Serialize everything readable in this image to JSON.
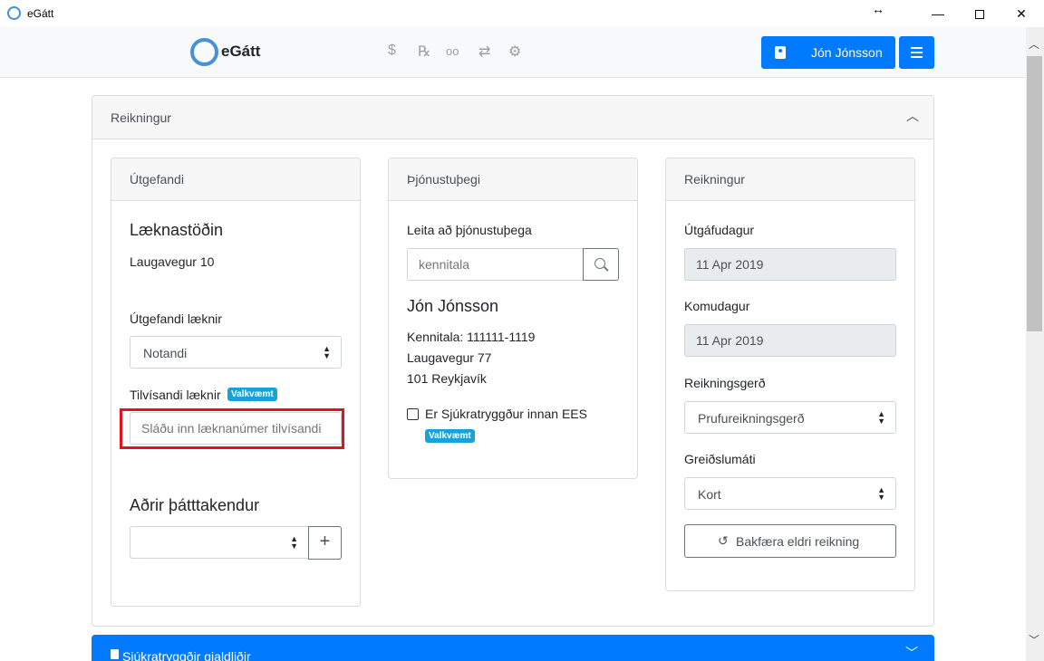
{
  "window": {
    "title": "eGátt",
    "resize_glyph": "↔",
    "minimize_glyph": "—",
    "close_glyph": "✕"
  },
  "header": {
    "logo_text": "eGátt",
    "nav_icons": [
      {
        "name": "dollar-icon",
        "glyph": "$"
      },
      {
        "name": "prescription-icon",
        "glyph": "℞"
      },
      {
        "name": "glasses-icon",
        "glyph": "oo"
      },
      {
        "name": "exchange-icon",
        "glyph": "⇄"
      },
      {
        "name": "settings-icon",
        "glyph": "⚙"
      }
    ],
    "user_button_label": "Jón Jónsson"
  },
  "main_card": {
    "title": "Reikningur"
  },
  "utgefandi": {
    "header": "Útgefandi",
    "clinic_name": "Læknastöðin",
    "clinic_address": "Laugavegur 10",
    "doctor_label": "Útgefandi læknir",
    "doctor_select_value": "Notandi",
    "referring_label": "Tilvísandi læknir",
    "optional_badge": "Valkvæmt",
    "referring_placeholder": "Sláðu inn læknanúmer tilvísandi",
    "other_participants_label": "Aðrir þátttakendur",
    "other_participants_value": ""
  },
  "thjonustuthegi": {
    "header": "Þjónustuþegi",
    "search_label": "Leita að þjónustuþega",
    "search_placeholder": "kennitala",
    "name": "Jón Jónsson",
    "kennitala_line": "Kennitala: 111111-1119",
    "address_line1": "Laugavegur 77",
    "address_line2": "101 Reykjavík",
    "ees_checkbox_label": "Er Sjúkratryggður innan EES",
    "ees_checked": false,
    "optional_badge": "Valkvæmt"
  },
  "reikningur": {
    "header": "Reikningur",
    "issue_date_label": "Útgáfudagur",
    "issue_date_value": "11 Apr 2019",
    "arrival_date_label": "Komudagur",
    "arrival_date_value": "11 Apr 2019",
    "invoice_type_label": "Reikningsgerð",
    "invoice_type_value": "Prufureikningsgerð",
    "payment_method_label": "Greiðslumáti",
    "payment_method_value": "Kort",
    "reverse_button_label": "Bakfæra eldri reikning"
  },
  "bottom_panel": {
    "title": "Sjúkratryggðir gjaldliðir"
  },
  "colors": {
    "primary": "#007bff",
    "badge": "#17a2d8",
    "highlight": "#e0141e"
  }
}
